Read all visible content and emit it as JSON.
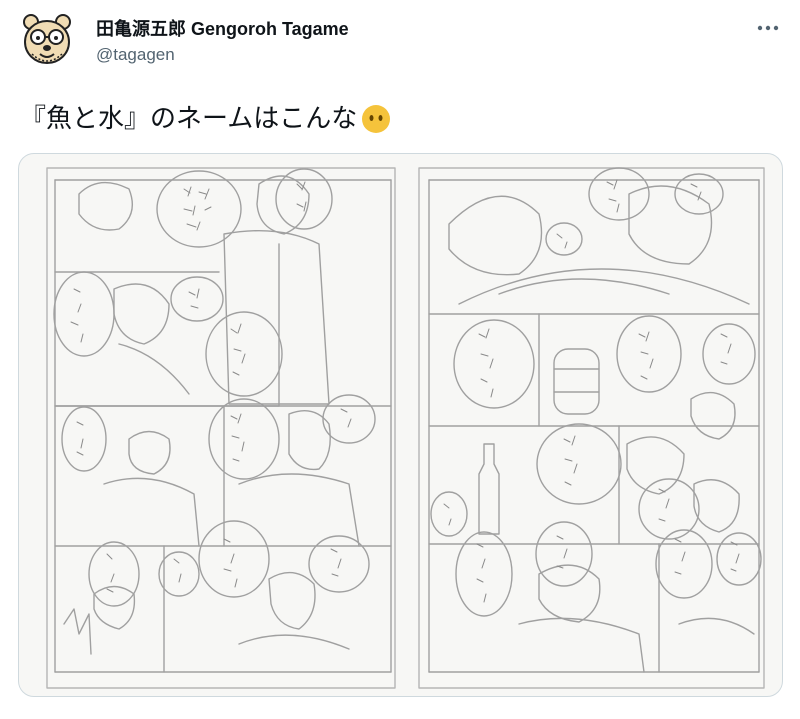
{
  "author": {
    "display_name": "田亀源五郎 Gengoroh Tagame",
    "handle": "@tagagen",
    "avatar_icon": "cartoon-bear-avatar-icon"
  },
  "tweet": {
    "text": "『魚と水』のネームはこんな",
    "emoji": "face-without-mouth-emoji",
    "more_icon": "more-dots-icon"
  },
  "media": {
    "description_icon": "manga-storyboard-sketch-image",
    "background_color": "#f7f7f5",
    "line_color": "#9a9a9a"
  },
  "colors": {
    "text_primary": "#0f1419",
    "text_secondary": "#536471",
    "border": "#cfd9de",
    "emoji_yellow": "#f5c33b"
  }
}
